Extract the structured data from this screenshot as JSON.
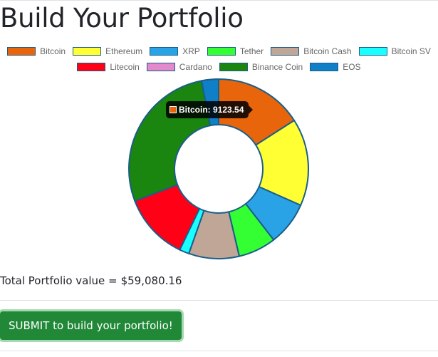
{
  "page": {
    "title": "Build Your Portfolio"
  },
  "chart_data": {
    "type": "pie",
    "variant": "doughnut",
    "categories": [
      "Bitcoin",
      "Ethereum",
      "XRP",
      "Tether",
      "Bitcoin Cash",
      "Bitcoin SV",
      "Litecoin",
      "Cardano",
      "Binance Coin",
      "EOS"
    ],
    "values": [
      9123.54,
      9000,
      4500,
      3900,
      5200,
      1000,
      6900,
      0,
      15900,
      1750
    ],
    "colors": [
      "#e8650b",
      "#ffff33",
      "#29a3e6",
      "#33ff33",
      "#bfa697",
      "#1affff",
      "#ff0016",
      "#e38acd",
      "#1a850f",
      "#0f7fc7"
    ],
    "border_color": "#1a5e8a",
    "legend": {
      "position": "top"
    },
    "tooltip": {
      "label": "Bitcoin: 9123.54",
      "series_index": 0
    }
  },
  "summary": {
    "total_label": "Total Portfolio value =",
    "total_value": "$59,080.16"
  },
  "actions": {
    "submit_label": "SUBMIT to build your portfolio!"
  }
}
